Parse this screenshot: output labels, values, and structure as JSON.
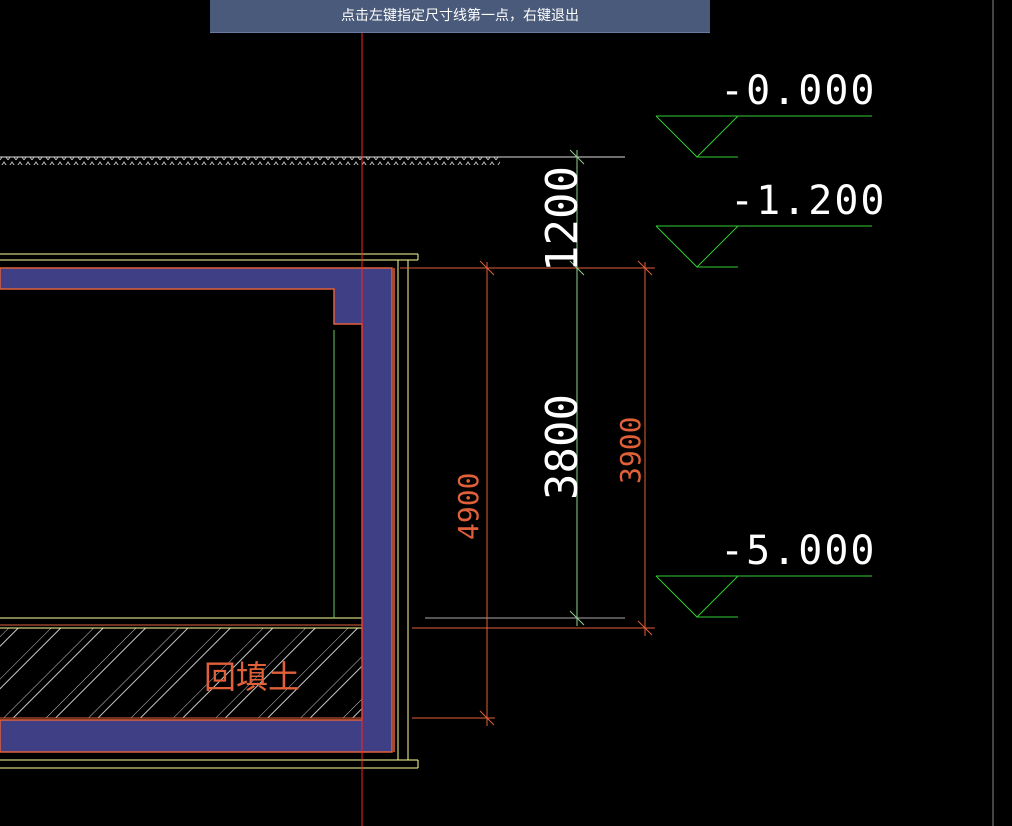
{
  "prompt": {
    "text": "点击左键指定尺寸线第一点，右键退出"
  },
  "elevations": [
    {
      "label": "-0.000"
    },
    {
      "label": "-1.200"
    },
    {
      "label": "-5.000"
    }
  ],
  "dimensions": {
    "d1200": "1200",
    "d3800": "3800",
    "d3900": "3900",
    "d4900": "4900"
  },
  "annotations": {
    "backfill": "回填土"
  },
  "colors": {
    "background": "#000000",
    "wall_fill": "#3f3f86",
    "outline": "#ffff99",
    "dim_red": "#e0603a",
    "dim_green": "#8fd08f",
    "elev_green": "#33cc33",
    "axis_red": "#ff2020"
  }
}
